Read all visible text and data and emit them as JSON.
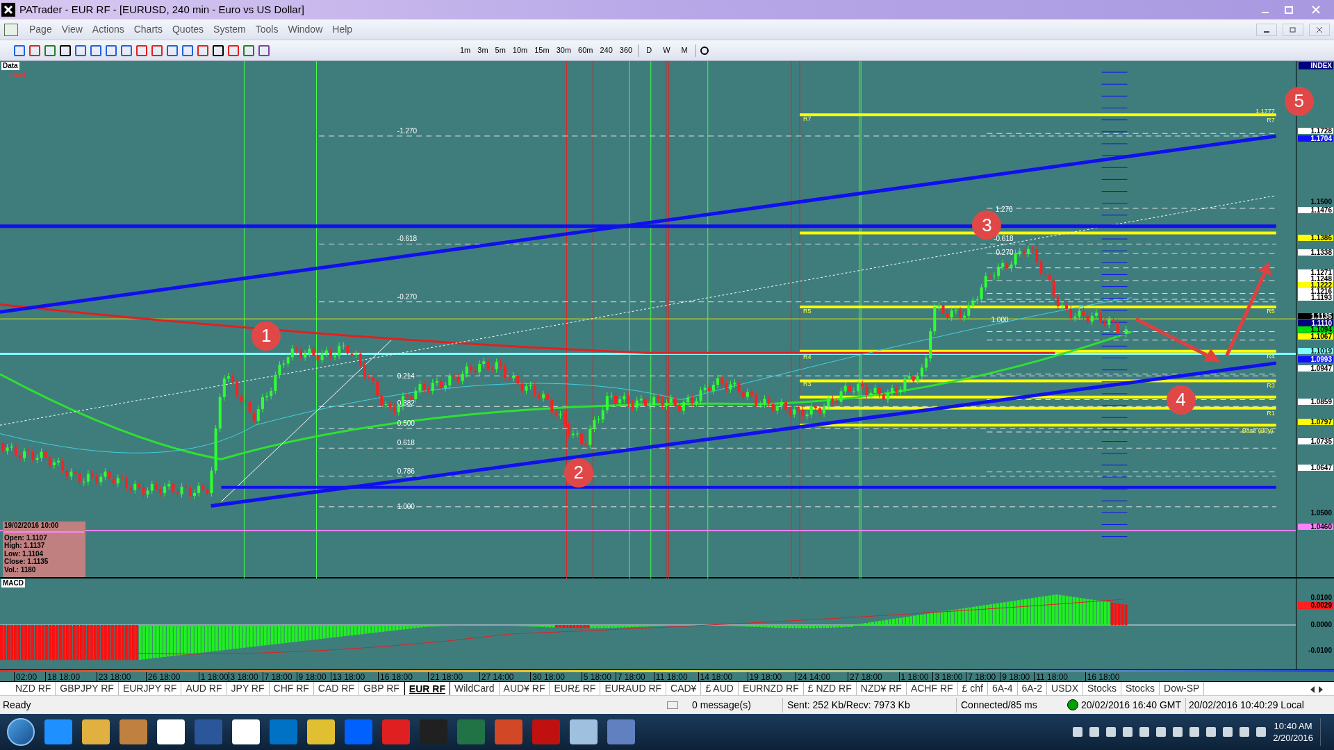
{
  "window": {
    "title": "PATrader - EUR RF - [EURUSD, 240 min - Euro vs US Dollar]"
  },
  "menu": [
    "Page",
    "View",
    "Actions",
    "Charts",
    "Quotes",
    "System",
    "Tools",
    "Window",
    "Help"
  ],
  "timeframes": [
    "1m",
    "3m",
    "5m",
    "10m",
    "15m",
    "30m",
    "60m",
    "240",
    "360"
  ],
  "periods": [
    "D",
    "W",
    "M"
  ],
  "chart": {
    "data_tag": "Data",
    "lock_status": "Locked",
    "fib_labels": [
      "-1.270",
      "-0.618",
      "-0.270",
      "0.214",
      "0.382",
      "0.500",
      "0.618",
      "0.786",
      "1.000",
      "1.270",
      "-0.618",
      "-0.270",
      "1.000"
    ],
    "level_labels": [
      "1.1777",
      "R7",
      "R7",
      "R5",
      "R5",
      "R4",
      "R4",
      "R3",
      "R3",
      "R1",
      "Base (Buy)"
    ],
    "markers": [
      "1",
      "2",
      "3",
      "4",
      "5"
    ],
    "info_box": {
      "date": "19/02/2016 10:00",
      "lines": [
        "Open: 1.1107",
        "High: 1.1137",
        "Low: 1.1104",
        "Close: 1.1135",
        "Vol.: 1180"
      ]
    },
    "price_axis": {
      "header": "INDEX",
      "labels": [
        {
          "text": "1.1728",
          "kind": "plain"
        },
        {
          "text": "1.1704",
          "kind": "blue"
        },
        {
          "text": "1.1500",
          "kind": "bare"
        },
        {
          "text": "1.1476",
          "kind": "plain"
        },
        {
          "text": "1.1386",
          "kind": "yellow"
        },
        {
          "text": "1.1338",
          "kind": "plain"
        },
        {
          "text": "1.1271",
          "kind": "plain"
        },
        {
          "text": "1.1248",
          "kind": "plain"
        },
        {
          "text": "1.1222",
          "kind": "yellow"
        },
        {
          "text": "1.1216",
          "kind": "plain"
        },
        {
          "text": "1.1193",
          "kind": "plain"
        },
        {
          "text": "1.1135",
          "kind": "black"
        },
        {
          "text": "1.1110",
          "kind": "navy"
        },
        {
          "text": "1.1094",
          "kind": "green"
        },
        {
          "text": "1.1067",
          "kind": "yellow"
        },
        {
          "text": "1.1019",
          "kind": "cyan"
        },
        {
          "text": "1.0993",
          "kind": "blue"
        },
        {
          "text": "1.0947",
          "kind": "plain"
        },
        {
          "text": "1.0859",
          "kind": "plain"
        },
        {
          "text": "1.0797",
          "kind": "yellow"
        },
        {
          "text": "1.0735",
          "kind": "plain"
        },
        {
          "text": "1.0647",
          "kind": "plain"
        },
        {
          "text": "1.0500",
          "kind": "bare"
        },
        {
          "text": "1.0460",
          "kind": "pink"
        }
      ]
    }
  },
  "macd": {
    "label": "MACD",
    "axis_labels": [
      {
        "text": "0.0100",
        "kind": "bare"
      },
      {
        "text": "0.0029",
        "kind": "red"
      },
      {
        "text": "0.0000",
        "kind": "bare"
      },
      {
        "text": "-0.0100",
        "kind": "bare"
      }
    ]
  },
  "x_axis": [
    "02:00",
    "18 18:00",
    "23 18:00",
    "26 18:00",
    "1 18:00",
    "3 18:00",
    "7 18:00",
    "9 18:00",
    "13 18:00",
    "16 18:00",
    "21 18:00",
    "27 14:00",
    "30 18:00",
    "5 18:00",
    "7 18:00",
    "11 18:00",
    "14 18:00",
    "19 18:00",
    "24 14:00",
    "27 18:00",
    "1 18:00",
    "3 18:00",
    "7 18:00",
    "9 18:00",
    "11 18:00",
    "16 18:00"
  ],
  "tabs": [
    {
      "label": "NZD RF",
      "selected": false
    },
    {
      "label": "GBPJPY RF",
      "selected": false
    },
    {
      "label": "EURJPY RF",
      "selected": false
    },
    {
      "label": "AUD RF",
      "selected": false
    },
    {
      "label": "JPY RF",
      "selected": false
    },
    {
      "label": "CHF RF",
      "selected": false
    },
    {
      "label": "CAD RF",
      "selected": false
    },
    {
      "label": "GBP RF",
      "selected": false
    },
    {
      "label": "EUR RF",
      "selected": true
    },
    {
      "label": "WildCard",
      "selected": false
    },
    {
      "label": "AUD¥ RF",
      "selected": false
    },
    {
      "label": "EUR£ RF",
      "selected": false
    },
    {
      "label": "EURAUD RF",
      "selected": false
    },
    {
      "label": "CAD¥",
      "selected": false
    },
    {
      "label": "£ AUD",
      "selected": false
    },
    {
      "label": "EURNZD RF",
      "selected": false
    },
    {
      "label": "£ NZD RF",
      "selected": false
    },
    {
      "label": "NZD¥ RF",
      "selected": false
    },
    {
      "label": "ACHF RF",
      "selected": false
    },
    {
      "label": "£ chf",
      "selected": false
    },
    {
      "label": "6A-4",
      "selected": false
    },
    {
      "label": "6A-2",
      "selected": false
    },
    {
      "label": "USDX",
      "selected": false
    },
    {
      "label": "Stocks",
      "selected": false
    },
    {
      "label": "Stocks",
      "selected": false
    },
    {
      "label": "Dow-SP",
      "selected": false
    }
  ],
  "status_bar": {
    "ready": "Ready",
    "messages": "0 message(s)",
    "traffic": "Sent: 252 Kb/Recv: 7973 Kb",
    "connection": "Connected/85 ms",
    "gmt_time": "20/02/2016 16:40 GMT",
    "local_time": "20/02/2016 10:40:29 Local"
  },
  "taskbar": {
    "time": "10:40 AM",
    "date": "2/20/2016"
  }
}
